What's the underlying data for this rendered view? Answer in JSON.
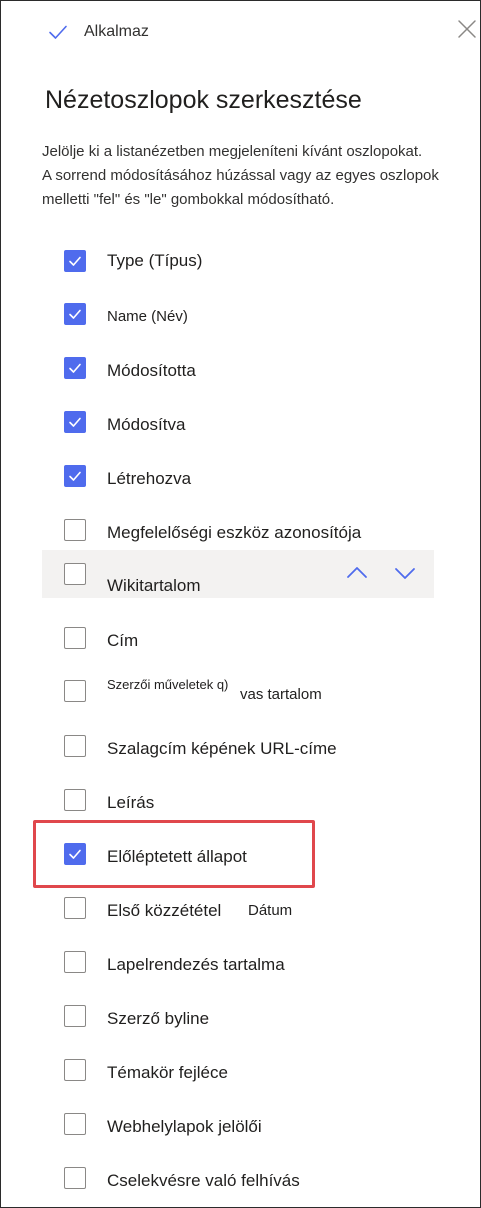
{
  "panel": {
    "apply_label": "Alkalmaz",
    "title": "Nézetoszlopok szerkesztése",
    "description": [
      "Jelölje ki a listanézetben megjeleníteni kívánt oszlopokat.",
      "A sorrend módosításához húzással vagy az egyes oszlopok",
      "melletti \"fel\" és \"le\" gombokkal módosítható."
    ]
  },
  "columns": [
    {
      "label": "Type (Típus)",
      "checked": true
    },
    {
      "label": "Name (Név)",
      "checked": true
    },
    {
      "label": "Módosította",
      "checked": true
    },
    {
      "label": "Módosítva",
      "checked": true
    },
    {
      "label": "Létrehozva",
      "checked": true
    },
    {
      "label": "Megfelelőségi eszköz azonosítója",
      "checked": false
    },
    {
      "label": "Wikitartalom",
      "checked": false
    },
    {
      "label": "Cím",
      "checked": false
    },
    {
      "label": "Szerzői műveletek q)",
      "extra": "vas tartalom",
      "checked": false
    },
    {
      "label": "Szalagcím képének URL-címe",
      "checked": false
    },
    {
      "label": "Leírás",
      "checked": false
    },
    {
      "label": "Előléptetett állapot",
      "checked": true
    },
    {
      "label": "Első közzététel",
      "extra": "Dátum",
      "checked": false
    },
    {
      "label": "Lapelrendezés tartalma",
      "checked": false
    },
    {
      "label": "Szerző byline",
      "checked": false
    },
    {
      "label": "Témakör fejléce",
      "checked": false
    },
    {
      "label": "Webhelylapok jelölői",
      "checked": false
    },
    {
      "label": "Cselekvésre való felhívás",
      "checked": false
    }
  ],
  "colors": {
    "accent": "#4f6bed",
    "highlight_border": "#e0474c",
    "hover_row": "#f3f2f1"
  }
}
